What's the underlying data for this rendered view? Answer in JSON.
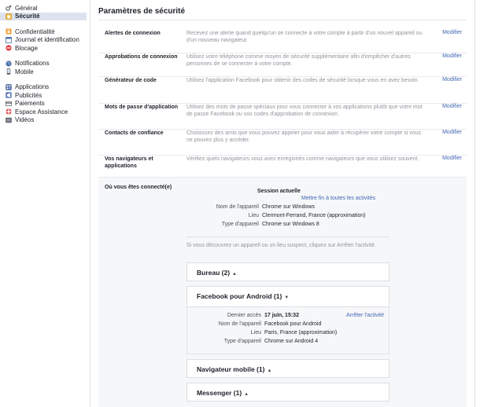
{
  "sidebar": {
    "groups": [
      [
        {
          "label": "Général",
          "icon": "gear-icon"
        },
        {
          "label": "Sécurité",
          "icon": "shield-icon",
          "active": true
        }
      ],
      [
        {
          "label": "Confidentialité",
          "icon": "lock-icon"
        },
        {
          "label": "Journal et identification",
          "icon": "journal-icon"
        },
        {
          "label": "Blocage",
          "icon": "block-icon"
        }
      ],
      [
        {
          "label": "Notifications",
          "icon": "globe-icon"
        },
        {
          "label": "Mobile",
          "icon": "phone-icon"
        }
      ],
      [
        {
          "label": "Applications",
          "icon": "apps-icon"
        },
        {
          "label": "Publicités",
          "icon": "ads-icon"
        },
        {
          "label": "Paiements",
          "icon": "card-icon"
        },
        {
          "label": "Espace Assistance",
          "icon": "help-icon"
        },
        {
          "label": "Vidéos",
          "icon": "video-icon"
        }
      ]
    ]
  },
  "main": {
    "title": "Paramètres de sécurité",
    "edit_label": "Modifier",
    "settings": [
      {
        "label": "Alertes de connexion",
        "desc": "Recevez une alerte quand quelqu'un se connecte à votre compte à partir d'un nouvel appareil ou d'un nouveau navigateur."
      },
      {
        "label": "Approbations de connexion",
        "desc": "Utilisez votre téléphone comme moyen de sécurité supplémentaire afin d'empêcher d'autres personnes de se connecter à votre compte."
      },
      {
        "label": "Générateur de code",
        "desc": "Utilisez l'application Facebook pour obtenir des codes de sécurité lorsque vous en avez besoin."
      },
      {
        "label": "Mots de passe d'application",
        "desc": "Utilisez des mots de passe spéciaux pour vous connecter à vos applications plutôt que votre mot de passe Facebook ou vos codes d'approbation de connexion."
      },
      {
        "label": "Contacts de confiance",
        "desc": "Choisissez des amis que vous pouvez appeler pour vous aider à récupérer votre compte si vous ne pouvez plus y accéder."
      },
      {
        "label": "Vos navigateurs et applications",
        "desc": "Vérifiez quels navigateurs vous avez enregistrés comme navigateurs que vous utilisez souvent."
      }
    ],
    "where": {
      "label": "Où vous êtes connecté(e)",
      "current_session": "Session actuelle",
      "end_all": "Mettre fin à toutes les activités",
      "current": [
        {
          "k": "Nom de l'appareil",
          "v": "Chrome sur Windows"
        },
        {
          "k": "Lieu",
          "v": "Clermont-Ferrand, France (approximation)"
        },
        {
          "k": "Type d'appareil",
          "v": "Chrome sur Windows 8"
        }
      ],
      "hint": "Si vous découvrez un appareil ou un lieu suspect, cliquez sur Arrêter l'activité.",
      "devices": {
        "bureau": "Bureau (2)",
        "android": "Facebook pour Android (1)",
        "mobile": "Navigateur mobile (1)",
        "messenger": "Messenger (1)"
      },
      "android_details": [
        {
          "k": "Dernier accès",
          "v": "17 juin, 15:32",
          "bold": true
        },
        {
          "k": "Nom de l'appareil",
          "v": "Facebook pour Android"
        },
        {
          "k": "Lieu",
          "v": "Paris, France (approximation)"
        },
        {
          "k": "Type d'appareil",
          "v": "Chrome sur Android 4"
        }
      ],
      "stop_activity": "Arrêter l'activité"
    }
  }
}
